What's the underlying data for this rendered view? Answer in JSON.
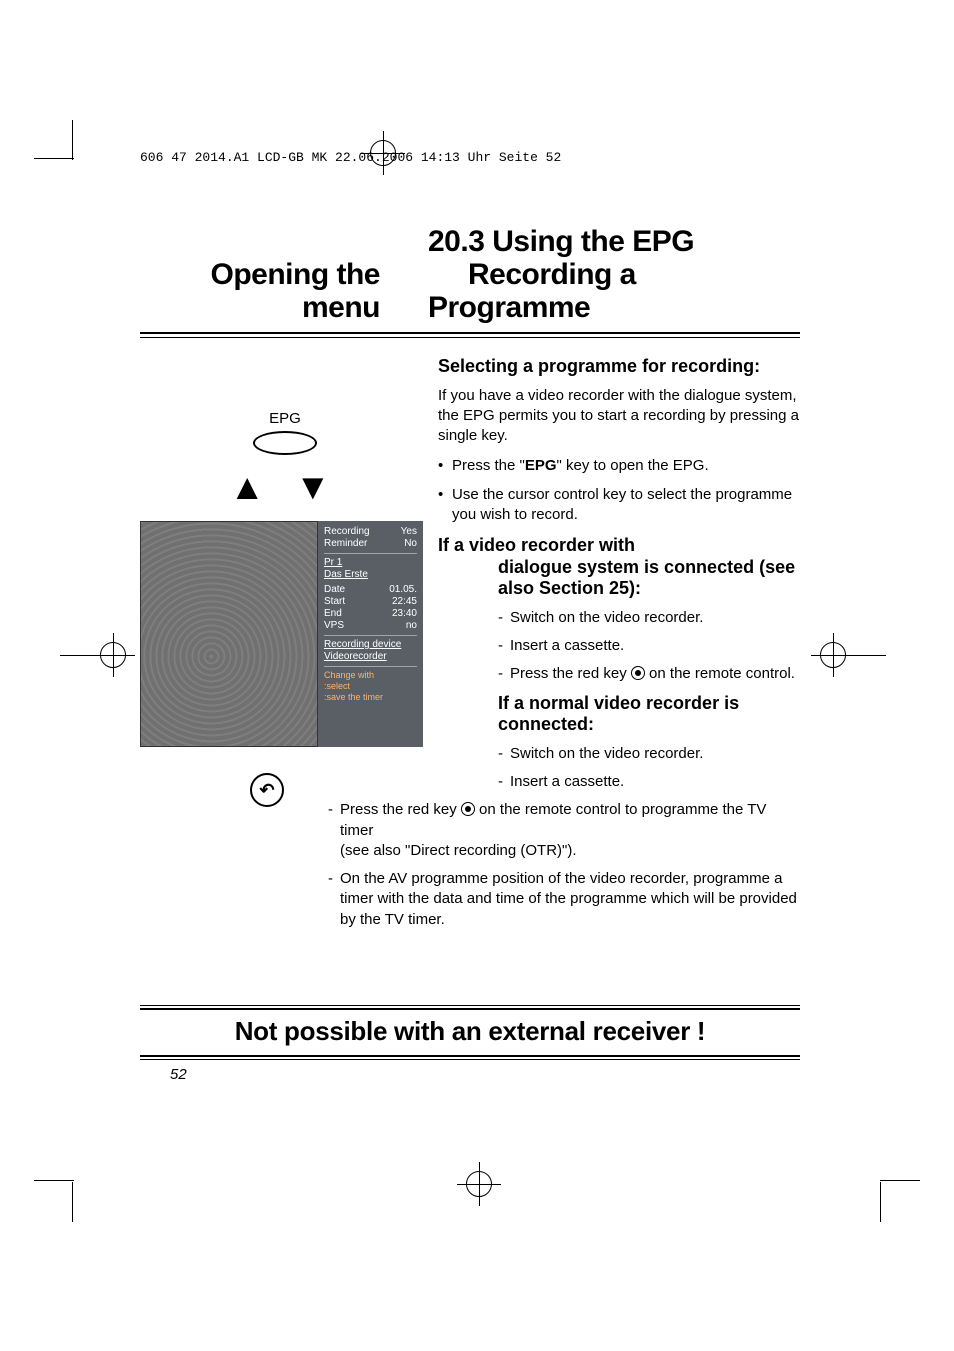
{
  "header_line": "606 47 2014.A1 LCD-GB  MK  22.06.2006  14:13 Uhr  Seite 52",
  "left_title": "Opening the menu",
  "right_title_line1": "20.3 Using the EPG",
  "right_title_line2": "Recording a Programme",
  "subheading1": "Selecting a programme for recording:",
  "para1": "If you have a video recorder with the dialogue system, the EPG permits you to start a recording by pressing a single key.",
  "bullet1_a": "Press the \"",
  "bullet1_b": "EPG",
  "bullet1_c": "\" key to open the EPG.",
  "bullet2": "Use the cursor control key to select the programme you wish to record.",
  "subheading2_line1": "If a video recorder with",
  "subheading2_line2": "dialogue system is connected (see also Section 25):",
  "dash_a1": "Switch on the video recorder.",
  "dash_a2": "Insert a cassette.",
  "dash_a3_a": "Press the red key ",
  "dash_a3_b": " on the remote control.",
  "subheading3": "If a normal video recorder is connected:",
  "dash_b1": "Switch on the video recorder.",
  "dash_b2": "Insert a cassette.",
  "dash_b3_a": "Press the red key ",
  "dash_b3_b": " on the remote control to programme the TV timer",
  "dash_b3_c": "(see also \"Direct recording (OTR)\").",
  "dash_b4": "On the AV programme position of the video recorder, programme a timer with the data and time of the programme which will be provided by the TV timer.",
  "epg_label": "EPG",
  "osd": {
    "recording": "Recording",
    "recording_val": "Yes",
    "reminder": "Reminder",
    "reminder_val": "No",
    "pr": "Pr   1",
    "channel": "Das Erste",
    "date": "Date",
    "date_val": "01.05.",
    "start": "Start",
    "start_val": "22:45",
    "end": "End",
    "end_val": "23:40",
    "vps": "VPS",
    "vps_val": "no",
    "recdev": "Recording device",
    "dev": "Videorecorder",
    "help1": "Change with",
    "help2": ":select",
    "help3": ":save the timer"
  },
  "footer_text": "Not possible with an external receiver !",
  "page_number": "52"
}
